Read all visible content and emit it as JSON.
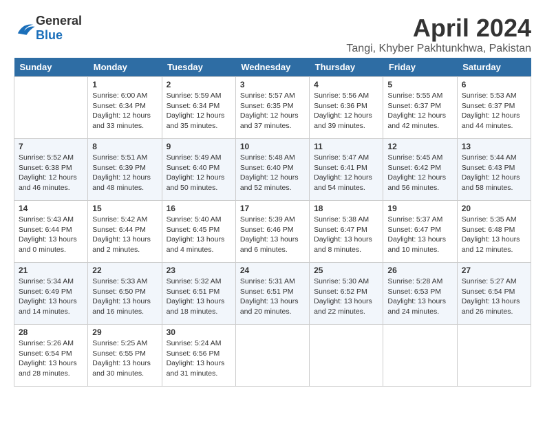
{
  "header": {
    "logo_general": "General",
    "logo_blue": "Blue",
    "title": "April 2024",
    "subtitle": "Tangi, Khyber Pakhtunkhwa, Pakistan"
  },
  "weekdays": [
    "Sunday",
    "Monday",
    "Tuesday",
    "Wednesday",
    "Thursday",
    "Friday",
    "Saturday"
  ],
  "weeks": [
    [
      {
        "day": "",
        "sunrise": "",
        "sunset": "",
        "daylight": ""
      },
      {
        "day": "1",
        "sunrise": "Sunrise: 6:00 AM",
        "sunset": "Sunset: 6:34 PM",
        "daylight": "Daylight: 12 hours and 33 minutes."
      },
      {
        "day": "2",
        "sunrise": "Sunrise: 5:59 AM",
        "sunset": "Sunset: 6:34 PM",
        "daylight": "Daylight: 12 hours and 35 minutes."
      },
      {
        "day": "3",
        "sunrise": "Sunrise: 5:57 AM",
        "sunset": "Sunset: 6:35 PM",
        "daylight": "Daylight: 12 hours and 37 minutes."
      },
      {
        "day": "4",
        "sunrise": "Sunrise: 5:56 AM",
        "sunset": "Sunset: 6:36 PM",
        "daylight": "Daylight: 12 hours and 39 minutes."
      },
      {
        "day": "5",
        "sunrise": "Sunrise: 5:55 AM",
        "sunset": "Sunset: 6:37 PM",
        "daylight": "Daylight: 12 hours and 42 minutes."
      },
      {
        "day": "6",
        "sunrise": "Sunrise: 5:53 AM",
        "sunset": "Sunset: 6:37 PM",
        "daylight": "Daylight: 12 hours and 44 minutes."
      }
    ],
    [
      {
        "day": "7",
        "sunrise": "Sunrise: 5:52 AM",
        "sunset": "Sunset: 6:38 PM",
        "daylight": "Daylight: 12 hours and 46 minutes."
      },
      {
        "day": "8",
        "sunrise": "Sunrise: 5:51 AM",
        "sunset": "Sunset: 6:39 PM",
        "daylight": "Daylight: 12 hours and 48 minutes."
      },
      {
        "day": "9",
        "sunrise": "Sunrise: 5:49 AM",
        "sunset": "Sunset: 6:40 PM",
        "daylight": "Daylight: 12 hours and 50 minutes."
      },
      {
        "day": "10",
        "sunrise": "Sunrise: 5:48 AM",
        "sunset": "Sunset: 6:40 PM",
        "daylight": "Daylight: 12 hours and 52 minutes."
      },
      {
        "day": "11",
        "sunrise": "Sunrise: 5:47 AM",
        "sunset": "Sunset: 6:41 PM",
        "daylight": "Daylight: 12 hours and 54 minutes."
      },
      {
        "day": "12",
        "sunrise": "Sunrise: 5:45 AM",
        "sunset": "Sunset: 6:42 PM",
        "daylight": "Daylight: 12 hours and 56 minutes."
      },
      {
        "day": "13",
        "sunrise": "Sunrise: 5:44 AM",
        "sunset": "Sunset: 6:43 PM",
        "daylight": "Daylight: 12 hours and 58 minutes."
      }
    ],
    [
      {
        "day": "14",
        "sunrise": "Sunrise: 5:43 AM",
        "sunset": "Sunset: 6:44 PM",
        "daylight": "Daylight: 13 hours and 0 minutes."
      },
      {
        "day": "15",
        "sunrise": "Sunrise: 5:42 AM",
        "sunset": "Sunset: 6:44 PM",
        "daylight": "Daylight: 13 hours and 2 minutes."
      },
      {
        "day": "16",
        "sunrise": "Sunrise: 5:40 AM",
        "sunset": "Sunset: 6:45 PM",
        "daylight": "Daylight: 13 hours and 4 minutes."
      },
      {
        "day": "17",
        "sunrise": "Sunrise: 5:39 AM",
        "sunset": "Sunset: 6:46 PM",
        "daylight": "Daylight: 13 hours and 6 minutes."
      },
      {
        "day": "18",
        "sunrise": "Sunrise: 5:38 AM",
        "sunset": "Sunset: 6:47 PM",
        "daylight": "Daylight: 13 hours and 8 minutes."
      },
      {
        "day": "19",
        "sunrise": "Sunrise: 5:37 AM",
        "sunset": "Sunset: 6:47 PM",
        "daylight": "Daylight: 13 hours and 10 minutes."
      },
      {
        "day": "20",
        "sunrise": "Sunrise: 5:35 AM",
        "sunset": "Sunset: 6:48 PM",
        "daylight": "Daylight: 13 hours and 12 minutes."
      }
    ],
    [
      {
        "day": "21",
        "sunrise": "Sunrise: 5:34 AM",
        "sunset": "Sunset: 6:49 PM",
        "daylight": "Daylight: 13 hours and 14 minutes."
      },
      {
        "day": "22",
        "sunrise": "Sunrise: 5:33 AM",
        "sunset": "Sunset: 6:50 PM",
        "daylight": "Daylight: 13 hours and 16 minutes."
      },
      {
        "day": "23",
        "sunrise": "Sunrise: 5:32 AM",
        "sunset": "Sunset: 6:51 PM",
        "daylight": "Daylight: 13 hours and 18 minutes."
      },
      {
        "day": "24",
        "sunrise": "Sunrise: 5:31 AM",
        "sunset": "Sunset: 6:51 PM",
        "daylight": "Daylight: 13 hours and 20 minutes."
      },
      {
        "day": "25",
        "sunrise": "Sunrise: 5:30 AM",
        "sunset": "Sunset: 6:52 PM",
        "daylight": "Daylight: 13 hours and 22 minutes."
      },
      {
        "day": "26",
        "sunrise": "Sunrise: 5:28 AM",
        "sunset": "Sunset: 6:53 PM",
        "daylight": "Daylight: 13 hours and 24 minutes."
      },
      {
        "day": "27",
        "sunrise": "Sunrise: 5:27 AM",
        "sunset": "Sunset: 6:54 PM",
        "daylight": "Daylight: 13 hours and 26 minutes."
      }
    ],
    [
      {
        "day": "28",
        "sunrise": "Sunrise: 5:26 AM",
        "sunset": "Sunset: 6:54 PM",
        "daylight": "Daylight: 13 hours and 28 minutes."
      },
      {
        "day": "29",
        "sunrise": "Sunrise: 5:25 AM",
        "sunset": "Sunset: 6:55 PM",
        "daylight": "Daylight: 13 hours and 30 minutes."
      },
      {
        "day": "30",
        "sunrise": "Sunrise: 5:24 AM",
        "sunset": "Sunset: 6:56 PM",
        "daylight": "Daylight: 13 hours and 31 minutes."
      },
      {
        "day": "",
        "sunrise": "",
        "sunset": "",
        "daylight": ""
      },
      {
        "day": "",
        "sunrise": "",
        "sunset": "",
        "daylight": ""
      },
      {
        "day": "",
        "sunrise": "",
        "sunset": "",
        "daylight": ""
      },
      {
        "day": "",
        "sunrise": "",
        "sunset": "",
        "daylight": ""
      }
    ]
  ]
}
